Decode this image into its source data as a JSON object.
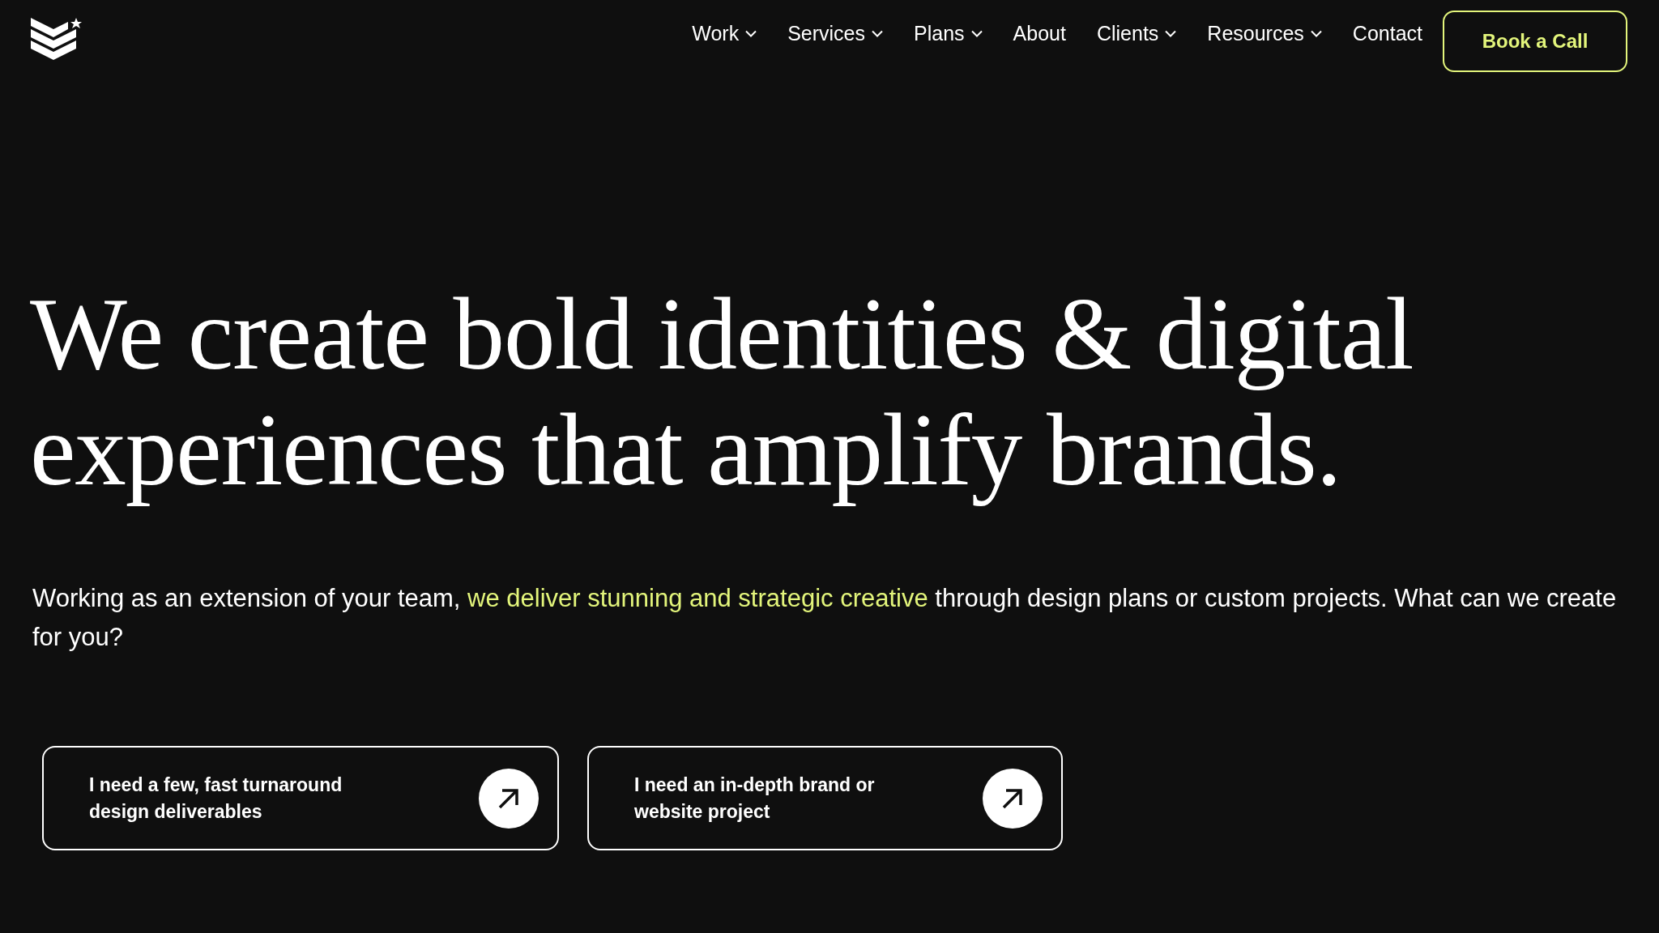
{
  "nav": {
    "items": [
      {
        "label": "Work",
        "dropdown": true
      },
      {
        "label": "Services",
        "dropdown": true
      },
      {
        "label": "Plans",
        "dropdown": true
      },
      {
        "label": "About",
        "dropdown": false
      },
      {
        "label": "Clients",
        "dropdown": true
      },
      {
        "label": "Resources",
        "dropdown": true
      },
      {
        "label": "Contact",
        "dropdown": false
      }
    ],
    "cta": "Book a Call"
  },
  "hero": {
    "headline": "We create bold identities & digital experiences that amplify brands.",
    "intro": {
      "before": "Working as an extension of your team, ",
      "highlight": "we deliver stunning and strategic creative",
      "after": " through design plans or custom projects. What can we create for you?"
    },
    "options": [
      {
        "label": "I need a few, fast turnaround design deliverables"
      },
      {
        "label": "I need an in-depth brand or website project"
      }
    ]
  }
}
